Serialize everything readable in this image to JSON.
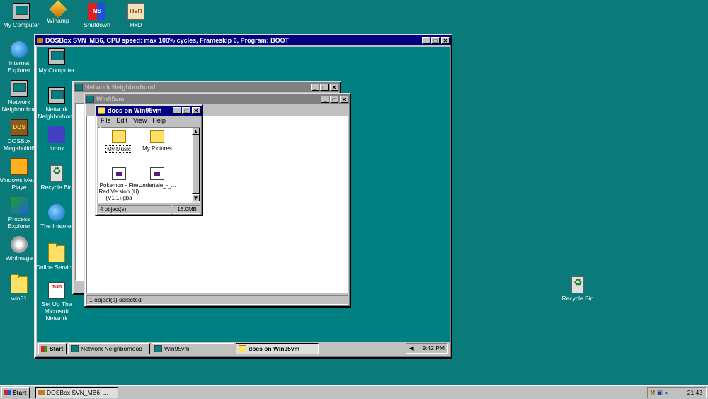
{
  "desktop_top": [
    {
      "label": "My Computer",
      "icon": "computer-icon"
    },
    {
      "label": "Winamp",
      "icon": "winamp-icon"
    },
    {
      "label": "Shutdown",
      "icon": "shutdown-icon"
    },
    {
      "label": "HxD",
      "icon": "hxd-icon"
    }
  ],
  "desktop_left": [
    {
      "label": "Internet Explorer",
      "icon": "internet-explorer-icon"
    },
    {
      "label": "Network Neighborhoo",
      "icon": "network-icon"
    },
    {
      "label": "DOSBox Megabuild6",
      "icon": "dosbox-icon"
    },
    {
      "label": "Windows Media Playe",
      "icon": "media-player-icon"
    },
    {
      "label": "Process Explorer",
      "icon": "process-explorer-icon"
    },
    {
      "label": "WinImage",
      "icon": "winimage-icon"
    },
    {
      "label": "win31",
      "icon": "folder-icon"
    }
  ],
  "desktop_recycle": {
    "label": "Recycle Bin",
    "icon": "recycle-bin-icon"
  },
  "dosbox": {
    "title": "DOSBox SVN_MB6, CPU speed: max 100% cycles, Frameskip  0, Program:     BOOT",
    "inner_icons": [
      {
        "label": "My Computer",
        "icon": "computer-icon"
      },
      {
        "label": "Network Neighborhood",
        "icon": "network-icon"
      },
      {
        "label": "Inbox",
        "icon": "inbox-icon"
      },
      {
        "label": "Recycle Bin",
        "icon": "recycle-bin-icon"
      },
      {
        "label": "The Internet",
        "icon": "internet-icon"
      },
      {
        "label": "Online Services",
        "icon": "folder-icon"
      },
      {
        "label": "Set Up The Microsoft Network",
        "icon": "msn-icon"
      }
    ]
  },
  "network_window": {
    "title": "Network Neighborhood"
  },
  "win95vm_window": {
    "title": "Win95vm",
    "status": "1 object(s) selected"
  },
  "docs_window": {
    "title": "docs on Win95vm",
    "menu": [
      "File",
      "Edit",
      "View",
      "Help"
    ],
    "files": [
      {
        "label": "My Music",
        "icon": "folder-icon"
      },
      {
        "label": "My Pictures",
        "icon": "folder-icon"
      },
      {
        "label": "Pokemon - Fire Red Version (U) (V1.1).gba",
        "icon": "gba-file-icon"
      },
      {
        "label": "Undertale_-_...",
        "icon": "file-icon"
      }
    ],
    "status_count": "4 object(s)",
    "status_size": "16.0MB"
  },
  "inner_taskbar": {
    "start": "Start",
    "buttons": [
      "Network Neighborhood",
      "Win95vm",
      "docs on Win95vm"
    ],
    "clock": "9:42 PM"
  },
  "host_taskbar": {
    "start": "Start",
    "task": "DOSBox SVN_MB6, ...",
    "clock": "21:42"
  }
}
